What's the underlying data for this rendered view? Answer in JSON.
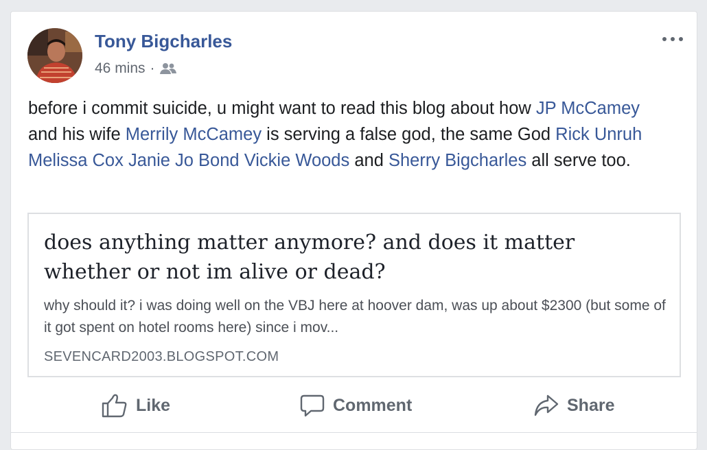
{
  "post": {
    "author": "Tony Bigcharles",
    "time": "46 mins",
    "separator": "·",
    "audience_icon": "friends-icon",
    "more_icon": "more-horizontal-icon",
    "text": {
      "p1": "before i commit suicide, u might want to read this blog about how ",
      "link1": "JP McCamey",
      "p2": " and his wife ",
      "link2": "Merrily McCamey",
      "p3": " is serving a false god, the same God ",
      "link3": "Rick Unruh",
      "p4": " ",
      "link4": "Melissa Cox",
      "p5": " ",
      "link5": "Janie Jo Bond",
      "p6": " ",
      "link6": "Vickie Woods",
      "p7": " and ",
      "link7": "Sherry Bigcharles",
      "p8": " all serve too."
    }
  },
  "link_preview": {
    "title": "does anything matter anymore? and does it matter whether or not im alive or dead?",
    "description": "why should it? i was doing well on the VBJ here at hoover dam, was up about $2300 (but some of it got spent on hotel rooms here) since i mov...",
    "domain": "SEVENCARD2003.BLOGSPOT.COM"
  },
  "actions": {
    "like": "Like",
    "comment": "Comment",
    "share": "Share"
  },
  "colors": {
    "link": "#385898",
    "text": "#1c1e21",
    "meta": "#616770",
    "background": "#e9ebee"
  }
}
